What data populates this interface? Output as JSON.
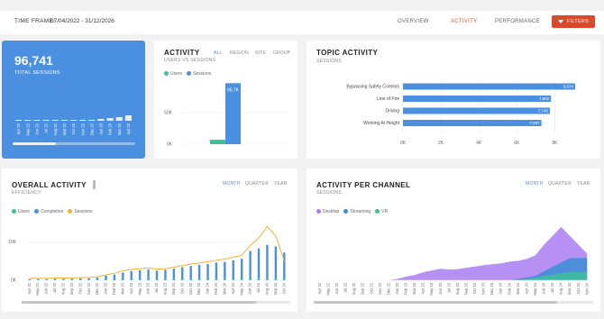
{
  "header": {
    "time_frame_label": "TIME FRAME:",
    "time_frame_value": "07/04/2022 - 31/12/2026",
    "nav": [
      "OVERVIEW",
      "ACTIVITY",
      "PERFORMANCE"
    ],
    "active_nav": "ACTIVITY",
    "filters_label": "FILTERS"
  },
  "kpi": {
    "value": "96,741",
    "label": "TOTAL SESSIONS",
    "spark_months": [
      "Apr 22",
      "May 22",
      "Jun 22",
      "Jul 22",
      "Aug 22",
      "Sep 22",
      "Oct 22",
      "Nov 22",
      "Dec 22",
      "Jan 23",
      "Feb 23",
      "Mar 23",
      "Apr 23"
    ],
    "spark_values": [
      1,
      1,
      1,
      1,
      1,
      1,
      1,
      1,
      1,
      2,
      3,
      4,
      6
    ]
  },
  "activity": {
    "title": "ACTIVITY",
    "subtitle": "USERS VS SESSIONS",
    "tabs": [
      "ALL",
      "REGION",
      "SITE",
      "GROUP"
    ],
    "active_tab": "ALL",
    "legend": [
      "Users",
      "Sessions"
    ],
    "colors": {
      "users": "#3dbf9a",
      "sessions": "#4a8fe0"
    }
  },
  "topic": {
    "title": "TOPIC ACTIVITY",
    "subtitle": "SESSIONS",
    "color": "#4a8fe0"
  },
  "overall": {
    "title": "OVERALL ACTIVITY",
    "subtitle": "EFFICIENCY",
    "tabs": [
      "MONTH",
      "QUARTER",
      "YEAR"
    ],
    "active_tab": "MONTH",
    "legend": [
      "Users",
      "Completion",
      "Sessions"
    ],
    "colors": {
      "users": "#3dbf9a",
      "completion": "#4a8fe0",
      "sessions": "#f2b233"
    }
  },
  "channel": {
    "title": "ACTIVITY PER CHANNEL",
    "subtitle": "SESSIONS",
    "tabs": [
      "MONTH",
      "QUARTER",
      "YEAR"
    ],
    "active_tab": "MONTH",
    "legend": [
      "Desktop",
      "Streaming",
      "VR"
    ],
    "colors": {
      "desktop": "#a97cf0",
      "streaming": "#3b8ed6",
      "vr": "#3dbf9a"
    }
  },
  "chart_data": [
    {
      "type": "bar",
      "title": "ACTIVITY",
      "categories": [
        "Users",
        "Sessions"
      ],
      "series": [
        {
          "name": "Users",
          "values": [
            7000,
            null
          ]
        },
        {
          "name": "Sessions",
          "values": [
            null,
            96700
          ]
        }
      ],
      "value_labels": [
        null,
        "96.7K"
      ],
      "ytick_labels": [
        "0K",
        "50K"
      ],
      "ylim": [
        0,
        100000
      ]
    },
    {
      "type": "bar",
      "orientation": "horizontal",
      "title": "TOPIC ACTIVITY",
      "categories": [
        "Bypassing Safety Controls",
        "Line of Fire",
        "Driving",
        "Working At Height"
      ],
      "values": [
        9074,
        7802,
        7745,
        7297
      ],
      "value_labels": [
        "9,074",
        "7,802",
        "7,745",
        "7,297"
      ],
      "xtick_labels": [
        "0K",
        "2K",
        "4K",
        "6K",
        "8K"
      ],
      "xlim": [
        0,
        9500
      ]
    },
    {
      "type": "bar",
      "title": "OVERALL ACTIVITY",
      "categories": [
        "Apr 22",
        "May 22",
        "Jun 22",
        "Jul 22",
        "Aug 22",
        "Sep 22",
        "Oct 22",
        "Nov 22",
        "Dec 22",
        "Jan 23",
        "Feb 23",
        "Mar 23",
        "Apr 23",
        "May 23",
        "Jun 23",
        "Jul 23",
        "Aug 23",
        "Sep 23",
        "Oct 23",
        "Nov 23",
        "Dec 23",
        "Jan 24",
        "Feb 24",
        "Mar 24",
        "Apr 24",
        "May 24",
        "Jun 24",
        "Jul 24",
        "Aug 24",
        "Sep 24",
        "Oct 24"
      ],
      "series": [
        {
          "name": "Users",
          "values": [
            100,
            100,
            100,
            100,
            100,
            100,
            100,
            100,
            100,
            150,
            200,
            250,
            300,
            300,
            350,
            300,
            300,
            350,
            350,
            400,
            400,
            400,
            450,
            450,
            500,
            500,
            550,
            550,
            600,
            600,
            500
          ]
        },
        {
          "name": "Completion",
          "values": [
            300,
            300,
            300,
            400,
            400,
            400,
            500,
            500,
            700,
            1200,
            1500,
            2000,
            2400,
            2600,
            2800,
            2500,
            2700,
            3000,
            3400,
            3700,
            4000,
            4200,
            4600,
            4800,
            5200,
            5600,
            7600,
            8300,
            9200,
            8800,
            7200
          ]
        },
        {
          "name": "Sessions",
          "values": [
            500,
            500,
            500,
            600,
            600,
            600,
            700,
            700,
            900,
            1400,
            1800,
            2500,
            2800,
            3000,
            3200,
            2900,
            3000,
            3400,
            3800,
            4200,
            4500,
            4800,
            5200,
            5500,
            6000,
            6500,
            9000,
            11000,
            14000,
            11500,
            5000
          ]
        }
      ],
      "ytick_labels": [
        "0K",
        "10K"
      ],
      "ylim": [
        0,
        15000
      ]
    },
    {
      "type": "area",
      "title": "ACTIVITY PER CHANNEL",
      "categories": [
        "Apr 22",
        "May 22",
        "Jun 22",
        "Jul 22",
        "Aug 22",
        "Sep 22",
        "Oct 22",
        "Nov 22",
        "Dec 22",
        "Jan 23",
        "Feb 23",
        "Mar 23",
        "Apr 23",
        "May 23",
        "Jun 23",
        "Jul 23",
        "Aug 23",
        "Sep 23",
        "Oct 23",
        "Nov 23",
        "Dec 23",
        "Jan 24",
        "Feb 24",
        "Mar 24",
        "Apr 24",
        "May 24",
        "Jun 24",
        "Jul 24",
        "Aug 24",
        "Sep 24",
        "Oct 24",
        "Nov 24"
      ],
      "series": [
        {
          "name": "Desktop",
          "values": [
            0,
            0,
            0,
            0,
            0,
            0,
            0,
            0,
            0,
            0.3,
            0.8,
            1.2,
            1.8,
            2.2,
            2.6,
            2.4,
            2.5,
            2.8,
            3.1,
            3.4,
            3.6,
            3.8,
            4.2,
            4.4,
            4.8,
            5.6,
            8,
            10,
            12,
            10,
            8,
            6
          ]
        },
        {
          "name": "Streaming",
          "values": [
            0,
            0,
            0,
            0,
            0,
            0,
            0,
            0,
            0,
            0,
            0,
            0,
            0,
            0,
            0,
            0,
            0,
            0,
            0,
            0,
            0,
            0,
            0,
            0.3,
            0.6,
            1,
            2,
            3,
            4,
            5,
            5,
            5
          ]
        },
        {
          "name": "VR",
          "values": [
            0,
            0,
            0,
            0,
            0,
            0,
            0,
            0,
            0,
            0,
            0,
            0,
            0,
            0,
            0,
            0,
            0,
            0,
            0,
            0,
            0,
            0,
            0,
            0,
            0.3,
            0.6,
            1,
            1.3,
            1.6,
            1.8,
            1.8,
            1.8
          ]
        }
      ]
    }
  ]
}
